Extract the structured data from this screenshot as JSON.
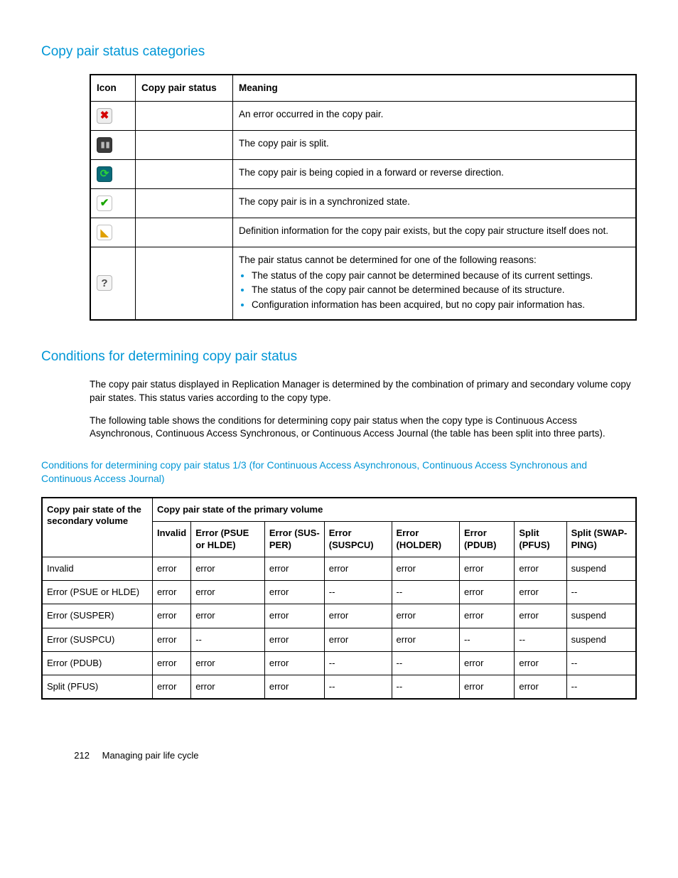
{
  "headings": {
    "h1": "Copy pair status categories",
    "h2": "Conditions for determining copy pair status"
  },
  "table1": {
    "headers": {
      "icon": "Icon",
      "status": "Copy pair status",
      "meaning": "Meaning"
    },
    "rows": [
      {
        "icon": "error",
        "status": "",
        "meaning": "An error occurred in the copy pair."
      },
      {
        "icon": "split",
        "status": "",
        "meaning": "The copy pair is split."
      },
      {
        "icon": "copying",
        "status": "",
        "meaning": "The copy pair is being copied in a forward or reverse direction."
      },
      {
        "icon": "sync",
        "status": "",
        "meaning": "The copy pair is in a synchronized state."
      },
      {
        "icon": "def",
        "status": "",
        "meaning": "Definition information for the copy pair exists, but the copy pair structure itself does not."
      },
      {
        "icon": "unknown",
        "status": "",
        "meaning_lead": "The pair status cannot be determined for one of the following reasons:",
        "reasons": [
          "The status of the copy pair cannot be determined because of its current settings.",
          "The status of the copy pair cannot be determined because of its structure.",
          "Configuration information has been acquired, but no copy pair information has."
        ]
      }
    ]
  },
  "paragraphs": {
    "p1": "The copy pair status displayed in Replication Manager is determined by the combination of primary and secondary volume copy pair states. This status varies according to the copy type.",
    "p2": "The following table shows the conditions for determining copy pair status when the copy type is Continuous Access Asynchronous, Continuous Access Synchronous, or Continuous Access Journal (the table has been split into three parts)."
  },
  "table2": {
    "caption": "Conditions for determining copy pair status 1/3 (for Continuous Access Asynchronous, Continuous Access Synchronous and Continuous Access Journal)",
    "rowHeaderTop": "Copy pair state of the secondary volume",
    "primaryHeaderTop": "Copy pair state of the primary volume",
    "columns": [
      "Invalid",
      "Error (PSUE or HLDE)",
      "Error (SUS-PER)",
      "Error (SUSPCU)",
      "Error (HOLDER)",
      "Error (PDUB)",
      "Split (PFUS)",
      "Split (SWAP-PING)"
    ],
    "rows": [
      {
        "label": "Invalid",
        "cells": [
          "error",
          "error",
          "error",
          "error",
          "error",
          "error",
          "error",
          "suspend"
        ]
      },
      {
        "label": "Error (PSUE or HLDE)",
        "cells": [
          "error",
          "error",
          "error",
          "--",
          "--",
          "error",
          "error",
          "--"
        ]
      },
      {
        "label": "Error (SUSPER)",
        "cells": [
          "error",
          "error",
          "error",
          "error",
          "error",
          "error",
          "error",
          "suspend"
        ]
      },
      {
        "label": "Error (SUSPCU)",
        "cells": [
          "error",
          "--",
          "error",
          "error",
          "error",
          "--",
          "--",
          "suspend"
        ]
      },
      {
        "label": "Error (PDUB)",
        "cells": [
          "error",
          "error",
          "error",
          "--",
          "--",
          "error",
          "error",
          "--"
        ]
      },
      {
        "label": "Split (PFUS)",
        "cells": [
          "error",
          "error",
          "error",
          "--",
          "--",
          "error",
          "error",
          "--"
        ]
      }
    ]
  },
  "footer": {
    "page": "212",
    "chapter": "Managing pair life cycle"
  }
}
